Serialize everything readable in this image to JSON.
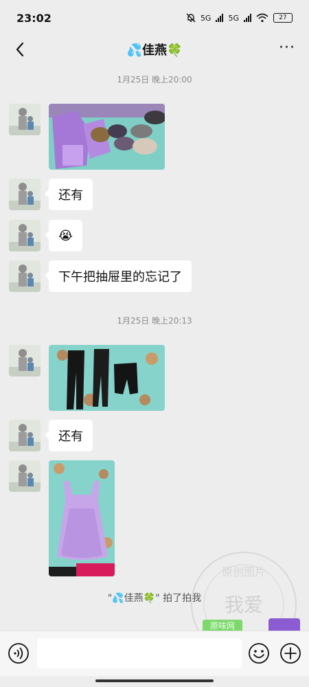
{
  "status_bar": {
    "time": "23:02",
    "network_1": "5G",
    "network_2": "5G",
    "wifi_sub": "6",
    "battery": "27"
  },
  "header": {
    "title": "💦佳燕🍀",
    "back_icon": "chevron-left-icon",
    "more_icon": "more-dots-icon",
    "more_label": "···"
  },
  "timestamps": [
    "1月25日 晚上20:00",
    "1月25日 晚上20:13"
  ],
  "messages": [
    {
      "type": "image",
      "subject": "clothes and bras on bedsheet"
    },
    {
      "type": "text",
      "text": "还有"
    },
    {
      "type": "emoji",
      "text": "😭"
    },
    {
      "type": "text",
      "text": "下午把抽屉里的忘记了"
    },
    {
      "type": "image",
      "subject": "black leggings and shorts"
    },
    {
      "type": "text",
      "text": "还有"
    },
    {
      "type": "image",
      "subject": "lilac camisole dress"
    }
  ],
  "notice": "\"💦佳燕🍀\" 拍了拍我",
  "watermark": {
    "line1": "我爱",
    "line2": "原创图片",
    "badge": "原味网"
  },
  "input_bar": {
    "voice_icon": "voice-icon",
    "emoji_icon": "emoji-face-icon",
    "plus_icon": "plus-circle-icon",
    "placeholder": ""
  },
  "colors": {
    "background": "#ededed",
    "bubble": "#ffffff",
    "timestamp": "#8c8c8c",
    "input_bar": "#f6f6f6"
  }
}
